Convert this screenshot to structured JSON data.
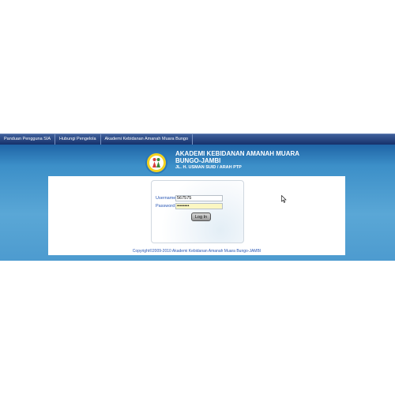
{
  "nav": {
    "items": [
      {
        "label": "Panduan Pengguna SIA"
      },
      {
        "label": "Hubungi Pengelola"
      },
      {
        "label": "Akademi Kebidanan Amanah Muara Bungo"
      }
    ]
  },
  "header": {
    "title": "AKADEMI KEBIDANAN AMANAH MUARA BUNGO-JAMBI",
    "address": "JL. H. USMAN SUID / ARAH PTP",
    "logo_icon": "school-logo-icon"
  },
  "login": {
    "username_label": "Username",
    "username_value": "567575",
    "password_label": "Password",
    "password_value": "12345678",
    "button_label": "Log In"
  },
  "footer": {
    "copyright": "Copyright©2009-2010 Akademi Kebidanan Amanah Muara Bungo-JAMBI"
  },
  "colors": {
    "nav_bg": "#15306a",
    "banner_bg": "#4d9bcf",
    "label": "#2a58b5",
    "password_field_bg": "#fbf7c2"
  }
}
